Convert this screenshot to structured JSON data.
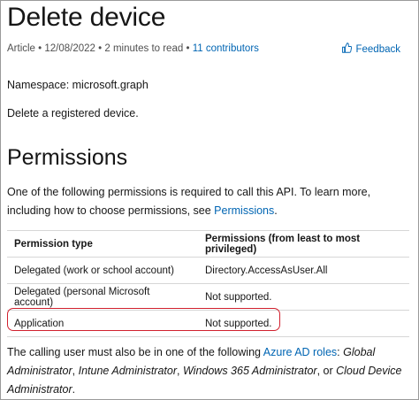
{
  "page": {
    "title": "Delete device",
    "meta": {
      "type": "Article",
      "date": "12/08/2022",
      "read_time": "2 minutes to read",
      "contributors": "11 contributors",
      "separator": "•"
    },
    "feedback_label": "Feedback",
    "namespace": "Namespace: microsoft.graph",
    "description": "Delete a registered device."
  },
  "permissions": {
    "heading": "Permissions",
    "intro_text": "One of the following permissions is required to call this API. To learn more, including how to choose permissions, see",
    "intro_link": "Permissions",
    "intro_end": ".",
    "table": {
      "headers": [
        "Permission type",
        "Permissions (from least to most privileged)"
      ],
      "rows": [
        [
          "Delegated (work or school account)",
          "Directory.AccessAsUser.All"
        ],
        [
          "Delegated (personal Microsoft account)",
          "Not supported."
        ],
        [
          "Application",
          "Not supported."
        ]
      ]
    },
    "highlight_color": "#d1202e",
    "footer": {
      "pre": "The calling user must also be in one of the following",
      "link": "Azure AD roles",
      "colon": ":",
      "roles_1": "Global Administrator",
      "comma_1": ",",
      "roles_2": "Intune Administrator",
      "comma_2": ",",
      "roles_3": "Windows 365 Administrator",
      "or": ", or",
      "roles_4": "Cloud Device Administrator",
      "end": "."
    }
  },
  "colors": {
    "link": "#0065b3",
    "text": "#161616"
  }
}
